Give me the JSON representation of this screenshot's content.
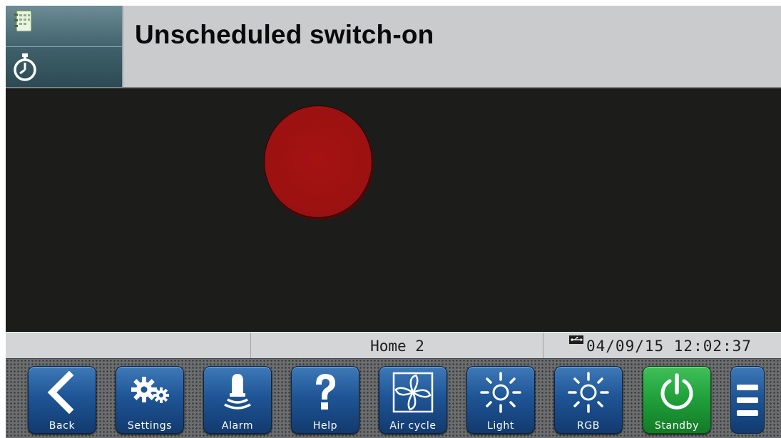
{
  "header": {
    "title": "Unscheduled switch-on",
    "mode_icons": [
      "calendar-icon",
      "stopwatch-icon"
    ]
  },
  "main": {
    "status_lamp_color": "#9b1111"
  },
  "status_bar": {
    "page_name": "Home 2",
    "datetime": "04/09/15 12:02:37",
    "usb_icon": "usb-icon"
  },
  "toolbar": {
    "buttons": [
      {
        "label": "Back",
        "icon": "back-arrow-icon"
      },
      {
        "label": "Settings",
        "icon": "gears-icon"
      },
      {
        "label": "Alarm",
        "icon": "bell-icon"
      },
      {
        "label": "Help",
        "icon": "question-mark-icon"
      },
      {
        "label": "Air cycle",
        "icon": "fan-icon"
      },
      {
        "label": "Light",
        "icon": "sun-icon"
      },
      {
        "label": "RGB",
        "icon": "sun-icon"
      },
      {
        "label": "Standby",
        "icon": "power-icon"
      }
    ],
    "menu_icon": "hamburger-menu-icon"
  },
  "colors": {
    "button_blue": "#1f5596",
    "button_green": "#21a23c",
    "header_bg": "#c9cbcd",
    "main_bg": "#1c1d1b"
  }
}
